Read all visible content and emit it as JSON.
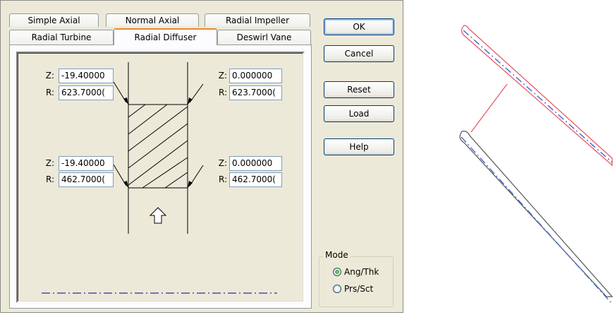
{
  "tabs": {
    "row1": [
      "Simple Axial",
      "Normal Axial",
      "Radial Impeller"
    ],
    "row2": [
      "Radial Turbine",
      "Radial Diffuser",
      "Deswirl Vane"
    ],
    "selected": "Radial Diffuser"
  },
  "points": {
    "top_left": {
      "z_label": "Z:",
      "r_label": "R:",
      "z": "-19.40000",
      "r": "623.7000("
    },
    "top_right": {
      "z_label": "Z:",
      "r_label": "R:",
      "z": "0.000000",
      "r": "623.7000("
    },
    "bottom_left": {
      "z_label": "Z:",
      "r_label": "R:",
      "z": "-19.40000",
      "r": "462.7000("
    },
    "bottom_right": {
      "z_label": "Z:",
      "r_label": "R:",
      "z": "0.000000",
      "r": "462.7000("
    }
  },
  "buttons": {
    "ok": "OK",
    "cancel": "Cancel",
    "reset": "Reset",
    "load": "Load",
    "help": "Help"
  },
  "mode": {
    "title": "Mode",
    "options": [
      "Ang/Thk",
      "Prs/Sct"
    ],
    "selected": "Ang/Thk"
  },
  "colors": {
    "suction_blade": "#e8505a",
    "pressure_blade": "#555555",
    "camber_line": "#4a6fd0"
  }
}
